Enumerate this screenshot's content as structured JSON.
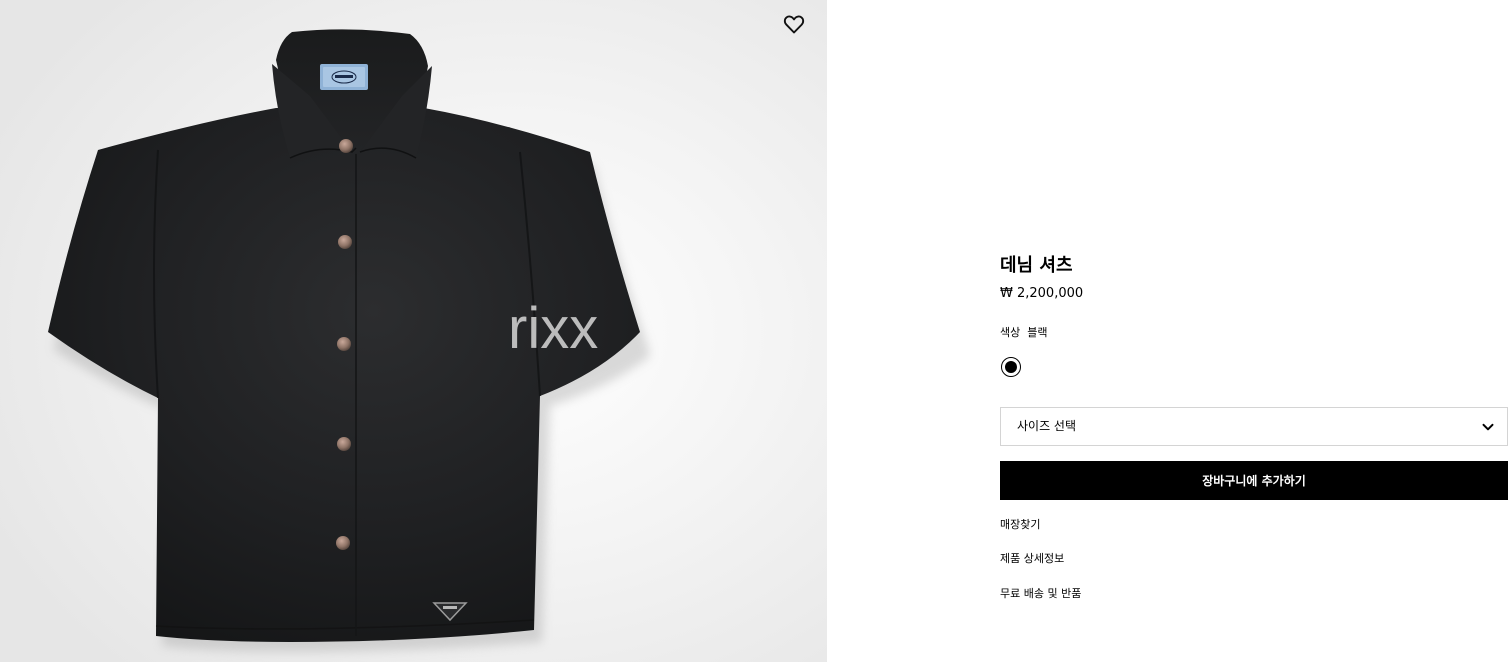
{
  "gallery": {
    "watermark": "rixx",
    "wishlist_icon": "heart-outline-icon"
  },
  "product": {
    "title": "데님 셔츠",
    "price": "₩ 2,200,000",
    "color_label": "색상",
    "color_value": "블랙",
    "swatch_color": "#000000"
  },
  "size_selector": {
    "label": "사이즈 선택",
    "icon": "chevron-down-icon"
  },
  "actions": {
    "add_to_cart": "장바구니에 추가하기",
    "links": [
      {
        "label": "매장찾기"
      },
      {
        "label": "제품 상세정보"
      },
      {
        "label": "무료 배송 및 반품"
      }
    ]
  }
}
